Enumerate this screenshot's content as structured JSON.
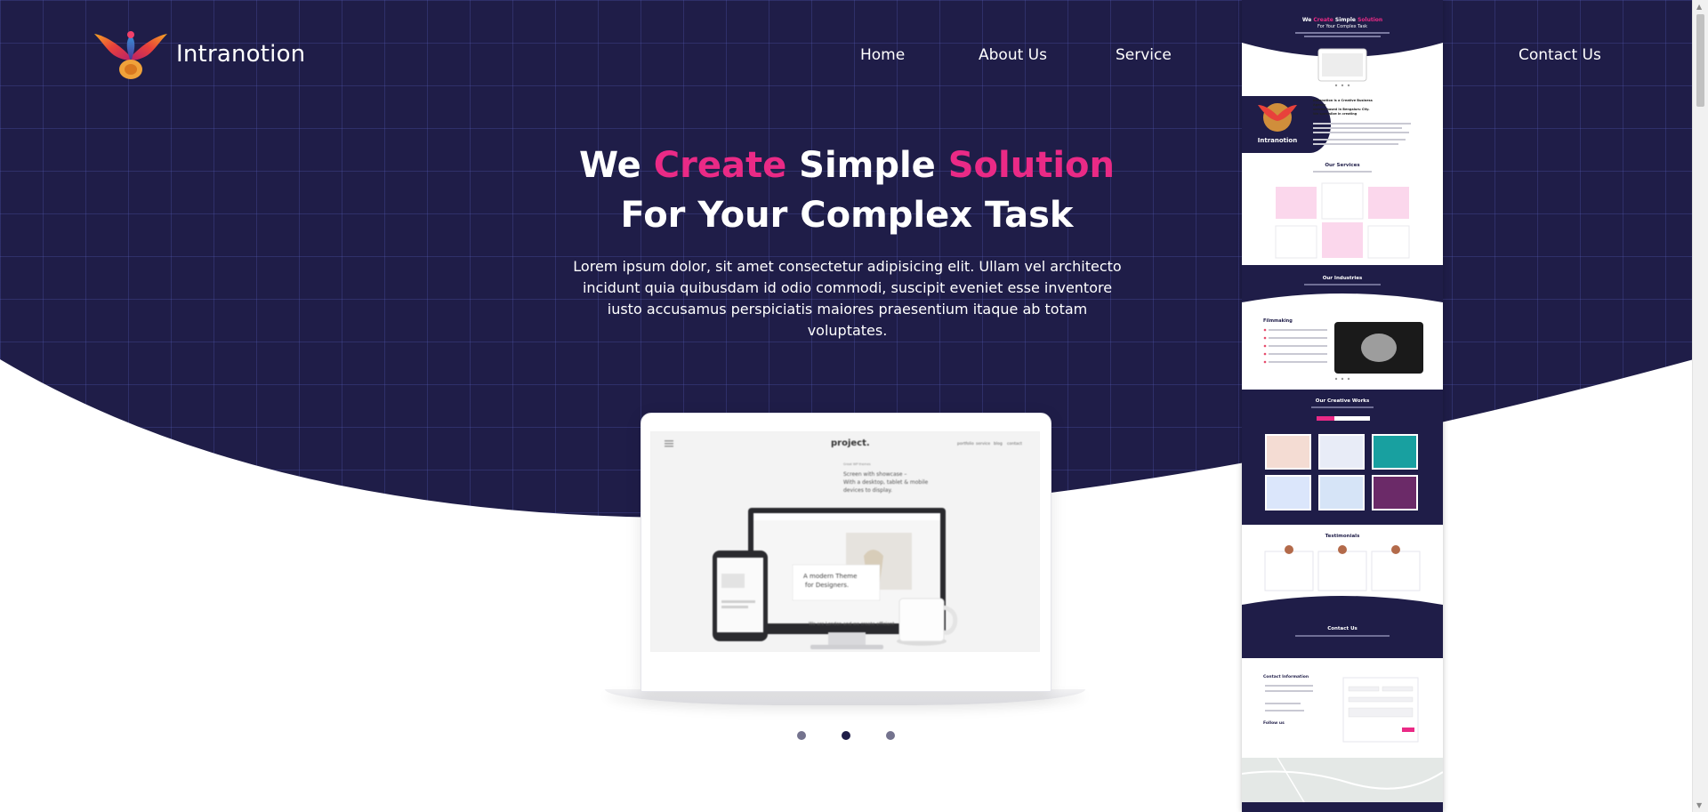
{
  "brand": {
    "name": "Intranotion"
  },
  "nav": {
    "home": "Home",
    "about": "About Us",
    "service": "Service",
    "contact": "Contact Us"
  },
  "hero": {
    "title_we": "We",
    "title_create": "Create",
    "title_simple": "Simple",
    "title_solution": "Solution",
    "title_line2": "For Your Complex Task",
    "text": "Lorem ipsum dolor, sit amet consectetur adipisicing elit. Ullam vel architecto incidunt quia quibusdam id odio commodi, suscipit eveniet esse inventore iusto accusamus perspiciatis maiores praesentium itaque ab totam voluptates."
  },
  "mockup": {
    "brand": "project.",
    "menu": [
      "portfolio",
      "service",
      "blog",
      "contact"
    ],
    "small_heading": "Great WP themes",
    "headline": [
      "Screen with showcase –",
      "With a desktop, tablet & mobile",
      "devices to display."
    ],
    "monitor_headline": [
      "A modern Theme",
      "for Designers."
    ],
    "monitor_caption": "We are London and we create efficient"
  },
  "carousel": {
    "slide_count": 3,
    "active_index": 1
  },
  "preview": {
    "title_we": "We",
    "title_create": "Create",
    "title_simple": "Simple",
    "title_solution": "Solution",
    "title_line2": "For Your Complex Task",
    "about_brand": "Intranotion",
    "about_lines": [
      "Intranotion is a Creative Business",
      "Agency",
      "service based in Bengaluru City.",
      "We specialize in creating"
    ],
    "services_title": "Our Services",
    "industries_title": "Our Industries",
    "filmmaking_title": "Filmmaking",
    "works_title": "Our Creative Works",
    "testimonials_title": "Testimonials",
    "contact_title": "Contact Us",
    "contact_info_title": "Contact Information",
    "follow_title": "Follow us"
  },
  "colors": {
    "navy": "#1f1d48",
    "accent": "#ea2a86",
    "white": "#ffffff",
    "grid": "#3a3f8c"
  }
}
